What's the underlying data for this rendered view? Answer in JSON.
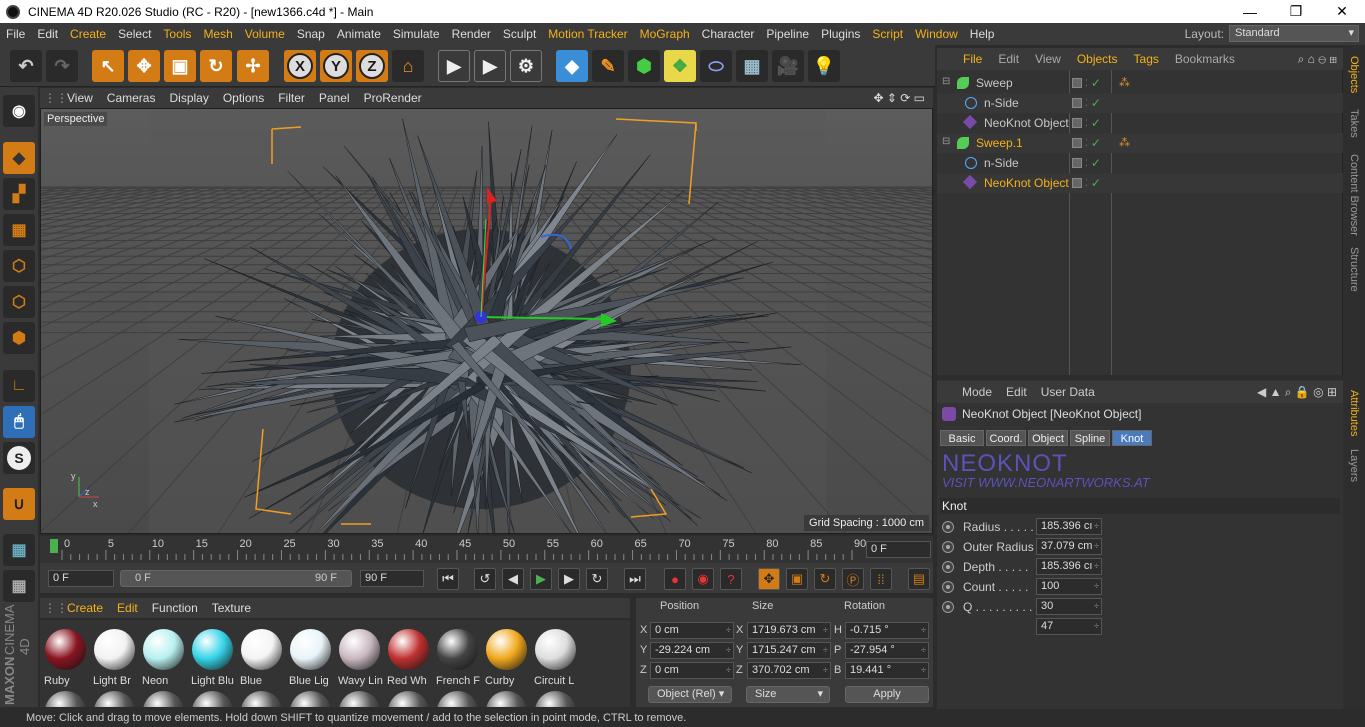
{
  "window": {
    "title": "CINEMA 4D R20.026 Studio (RC - R20) - [new1366.c4d *] - Main",
    "minimize": "—",
    "maximize": "❐",
    "close": "✕"
  },
  "menu": [
    "File",
    "Edit",
    "Create",
    "Select",
    "Tools",
    "Mesh",
    "Volume",
    "Snap",
    "Animate",
    "Simulate",
    "Render",
    "Sculpt",
    "Motion Tracker",
    "MoGraph",
    "Character",
    "Pipeline",
    "Plugins",
    "Script",
    "Window",
    "Help"
  ],
  "menu_highlight": [
    "Create",
    "Tools",
    "Mesh",
    "Volume",
    "Motion Tracker",
    "MoGraph",
    "Script",
    "Window"
  ],
  "layout": {
    "label": "Layout:",
    "value": "Standard"
  },
  "toolbar_letters": {
    "x": "X",
    "y": "Y",
    "z": "Z"
  },
  "viewport_menu": [
    "View",
    "Cameras",
    "Display",
    "Options",
    "Filter",
    "Panel",
    "ProRender"
  ],
  "viewport": {
    "camera_label": "Perspective",
    "grid_spacing": "Grid Spacing : 1000 cm"
  },
  "timeline": {
    "ticks": [
      "0",
      "5",
      "10",
      "15",
      "20",
      "25",
      "30",
      "35",
      "40",
      "45",
      "50",
      "55",
      "60",
      "65",
      "70",
      "75",
      "80",
      "85",
      "90"
    ],
    "current": "0 F"
  },
  "transport": {
    "start": "0 F",
    "range_start": "0 F",
    "range_end": "90 F",
    "end": "90 F"
  },
  "materials_menu": [
    "Create",
    "Edit",
    "Function",
    "Texture"
  ],
  "materials": [
    {
      "name": "Ruby",
      "color": "#8a1520"
    },
    {
      "name": "Light Br",
      "color": "#f2f2f2"
    },
    {
      "name": "Neon",
      "color": "#b8f0f0"
    },
    {
      "name": "Light Blu",
      "color": "#35d4e8"
    },
    {
      "name": "Blue",
      "color": "#f4f4f4"
    },
    {
      "name": "Blue Lig",
      "color": "#e8f4f8"
    },
    {
      "name": "Wavy Lin",
      "color": "#c9b8c0"
    },
    {
      "name": "Red Wh",
      "color": "#c03030"
    },
    {
      "name": "French F",
      "color": "#444444"
    },
    {
      "name": "Curby",
      "color": "#f0a81c"
    },
    {
      "name": "Circuit L",
      "color": "#dddddd"
    }
  ],
  "coords": {
    "headers": [
      "Position",
      "Size",
      "Rotation"
    ],
    "rows": [
      {
        "axis": "X",
        "pos": "0 cm",
        "size_axis": "X",
        "size": "1719.673 cm",
        "rot_axis": "H",
        "rot": "-0.715 °"
      },
      {
        "axis": "Y",
        "pos": "-29.224 cm",
        "size_axis": "Y",
        "size": "1715.247 cm",
        "rot_axis": "P",
        "rot": "-27.954 °"
      },
      {
        "axis": "Z",
        "pos": "0 cm",
        "size_axis": "Z",
        "size": "370.702 cm",
        "rot_axis": "B",
        "rot": "19.441 °"
      }
    ],
    "mode": "Object (Rel)",
    "size_mode": "Size",
    "apply": "Apply"
  },
  "status": "Move: Click and drag to move elements. Hold down SHIFT to quantize movement / add to the selection in point mode, CTRL to remove.",
  "objects_menu": [
    "File",
    "Edit",
    "View",
    "Objects",
    "Tags",
    "Bookmarks"
  ],
  "objects": [
    {
      "name": "Sweep",
      "indent": 0,
      "color": "#c8c8c8"
    },
    {
      "name": "n-Side",
      "indent": 1,
      "color": "#c8c8c8"
    },
    {
      "name": "NeoKnot Object",
      "indent": 1,
      "color": "#c8c8c8"
    },
    {
      "name": "Sweep.1",
      "indent": 0,
      "color": "#f4b21a"
    },
    {
      "name": "n-Side",
      "indent": 1,
      "color": "#c8c8c8"
    },
    {
      "name": "NeoKnot Object",
      "indent": 1,
      "color": "#f4b21a"
    }
  ],
  "side_tabs_top": [
    "Objects",
    "Takes",
    "Content Browser",
    "Structure"
  ],
  "side_tabs_bottom": [
    "Attributes",
    "Layers"
  ],
  "attributes": {
    "menu": [
      "Mode",
      "Edit",
      "User Data"
    ],
    "object_title": "NeoKnot Object [NeoKnot Object]",
    "tabs": [
      "Basic",
      "Coord.",
      "Object",
      "Spline",
      "Knot"
    ],
    "active_tab": "Knot",
    "logo": "NEOKNOT",
    "logo_sub": "VISIT WWW.NEONARTWORKS.AT",
    "section": "Knot",
    "params": [
      {
        "label": "Radius . . . . .",
        "value": "185.396 cı"
      },
      {
        "label": "Outer Radius",
        "value": "37.079 cm"
      },
      {
        "label": "Depth . . . . .",
        "value": "185.396 cı"
      },
      {
        "label": "Count . . . . .",
        "value": "100"
      },
      {
        "label": "Q . . . . . . . . . .",
        "value": "30"
      },
      {
        "label": "",
        "value": "47"
      }
    ]
  },
  "brand": {
    "maxon": "MAXON",
    "cinema": "CINEMA 4D"
  }
}
